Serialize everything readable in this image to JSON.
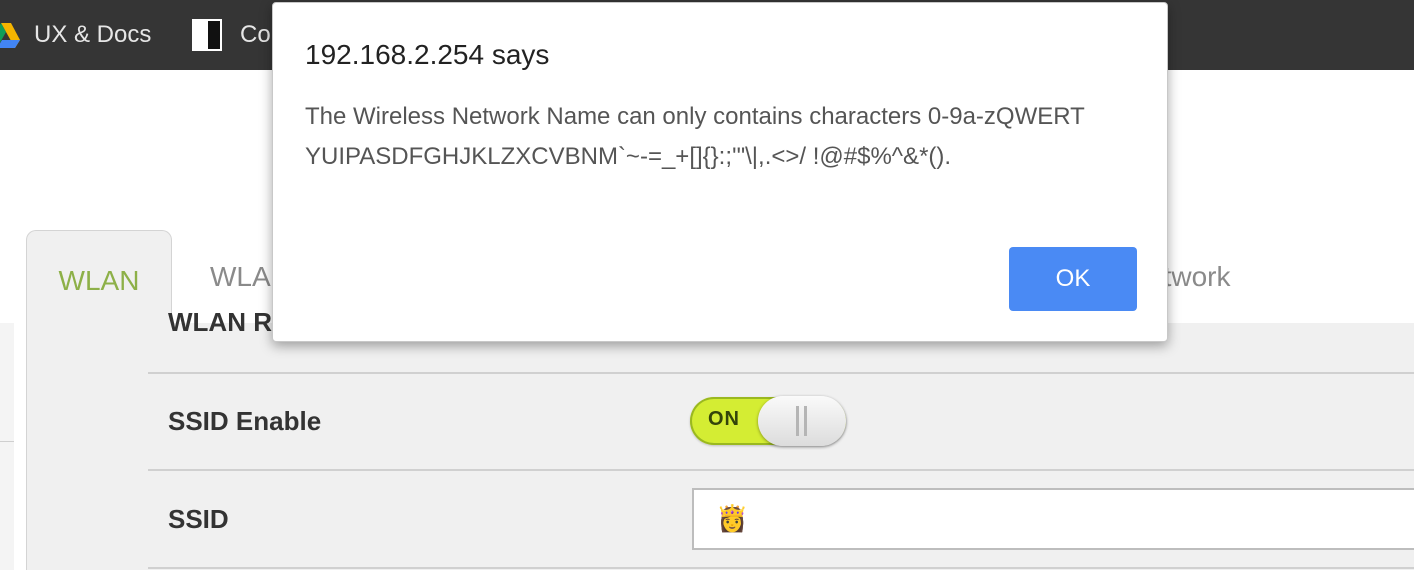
{
  "bookmarks": {
    "items": [
      {
        "label": "UX & Docs",
        "icon": "google-drive-icon"
      },
      {
        "label": "Co",
        "icon": "document-icon"
      }
    ]
  },
  "tabs": [
    "WLAN",
    "WLA",
    "etwork"
  ],
  "section": {
    "heading_partial": "WLAN R"
  },
  "rows": {
    "ssid_enable_label": "SSID Enable",
    "toggle_state": "ON",
    "ssid_label": "SSID",
    "ssid_value": "👸"
  },
  "dialog": {
    "title": "192.168.2.254 says",
    "message": "The Wireless Network Name can only contains characters 0-9a-zQWERTYUIPASDFGHJKLZXCVBNM`~-=_+[]{}:;'\"\\|,.<>/ !@#$%^&*().",
    "ok_label": "OK"
  },
  "colors": {
    "accent_tab": "#8db048",
    "toggle_on": "#d4ed33",
    "ok_button": "#4a8af4",
    "bookmarks_bar": "#353535"
  }
}
